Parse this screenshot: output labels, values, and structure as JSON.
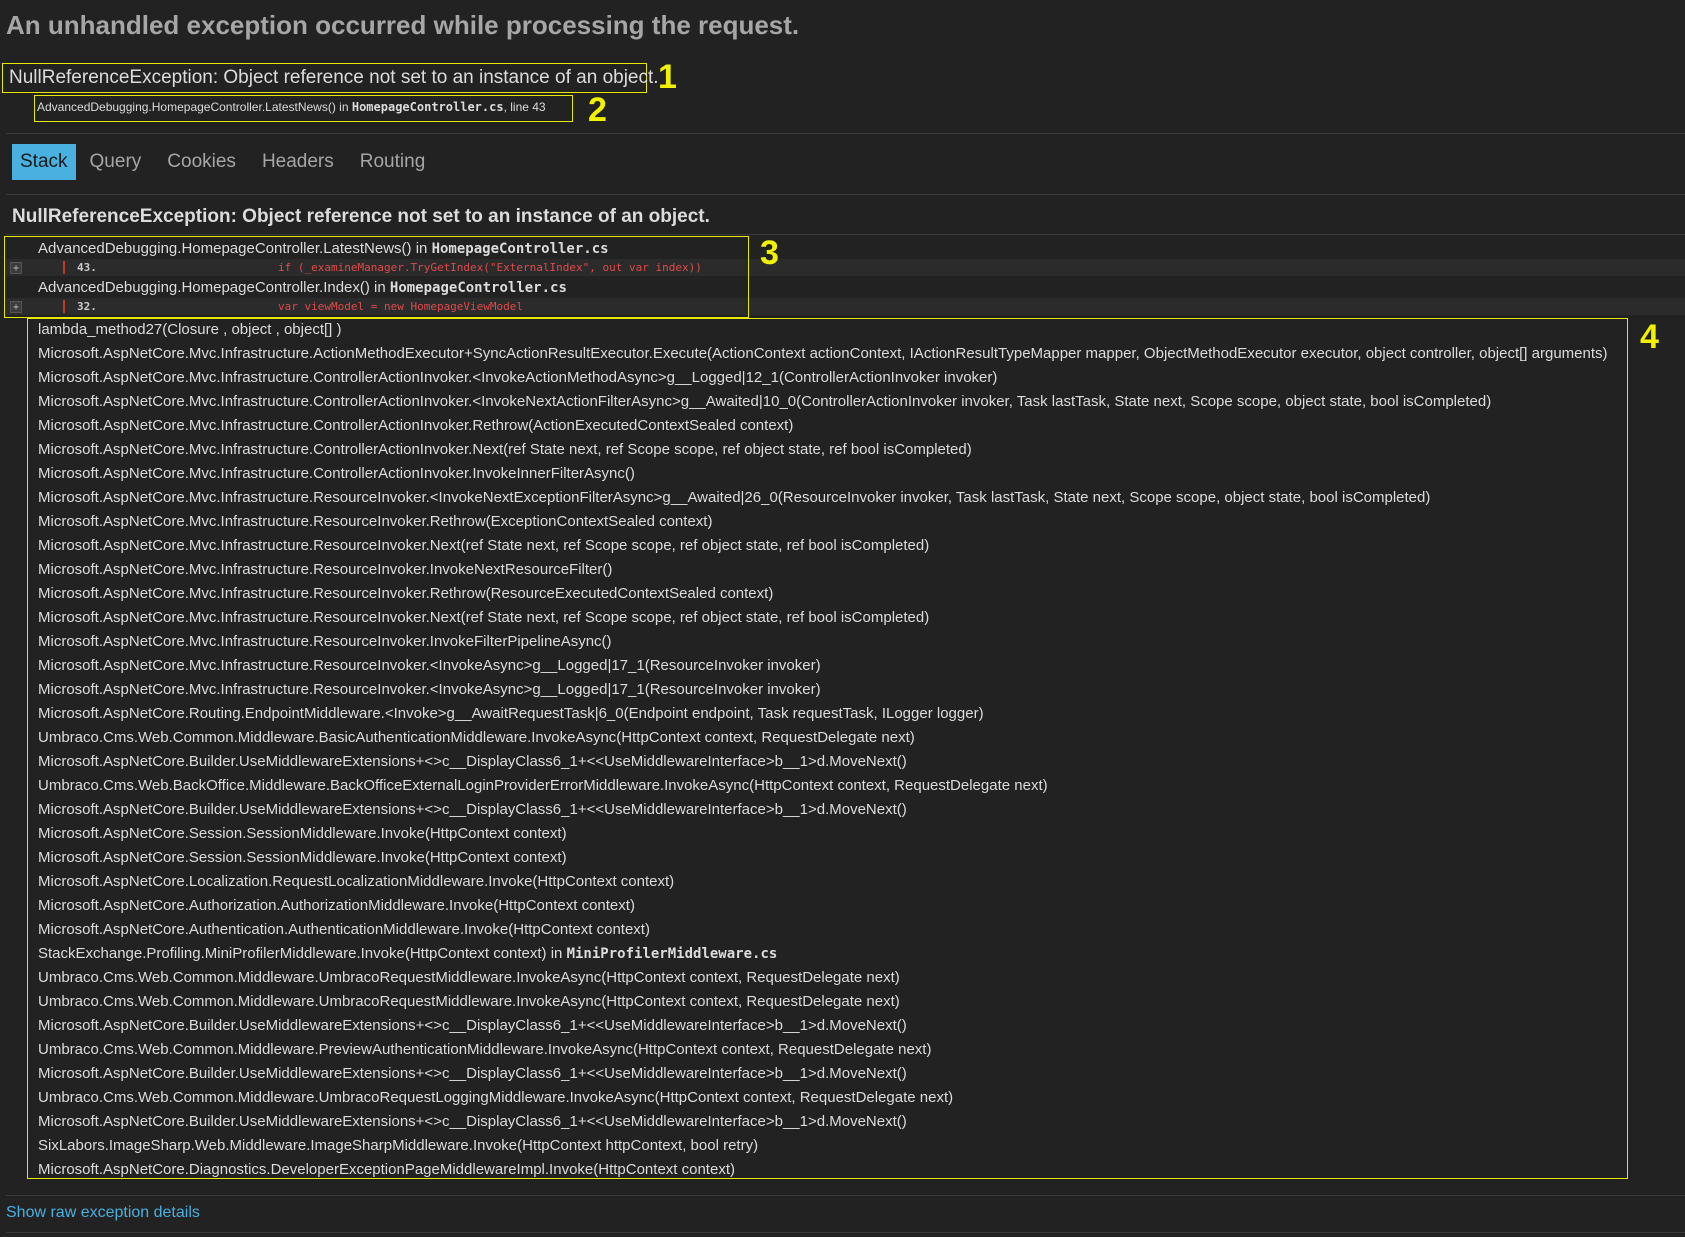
{
  "page": {
    "title": "An unhandled exception occurred while processing the request."
  },
  "exception": {
    "summary": "NullReferenceException: Object reference not set to an instance of an object.",
    "location_method": "AdvancedDebugging.HomepageController.LatestNews() in ",
    "location_file": "HomepageController.cs",
    "location_line": ", line 43"
  },
  "annotations": [
    "1",
    "2",
    "3",
    "4"
  ],
  "tabs": [
    {
      "label": "Stack",
      "active": true
    },
    {
      "label": "Query",
      "active": false
    },
    {
      "label": "Cookies",
      "active": false
    },
    {
      "label": "Headers",
      "active": false
    },
    {
      "label": "Routing",
      "active": false
    }
  ],
  "stack": {
    "heading": "NullReferenceException: Object reference not set to an instance of an object.",
    "expand_symbol": "+",
    "top_frames": [
      {
        "method": "AdvancedDebugging.HomepageController.LatestNews() in ",
        "file": "HomepageController.cs",
        "line_number": "43.",
        "code": "if (_examineManager.TryGetIndex(\"ExternalIndex\", out var index))"
      },
      {
        "method": "AdvancedDebugging.HomepageController.Index() in ",
        "file": "HomepageController.cs",
        "line_number": "32.",
        "code": "var viewModel = new HomepageViewModel"
      }
    ],
    "frames": [
      {
        "method": "lambda_method27(Closure , object , object[] )"
      },
      {
        "method": "Microsoft.AspNetCore.Mvc.Infrastructure.ActionMethodExecutor+SyncActionResultExecutor.Execute(ActionContext actionContext, IActionResultTypeMapper mapper, ObjectMethodExecutor executor, object controller, object[] arguments)"
      },
      {
        "method": "Microsoft.AspNetCore.Mvc.Infrastructure.ControllerActionInvoker.<InvokeActionMethodAsync>g__Logged|12_1(ControllerActionInvoker invoker)"
      },
      {
        "method": "Microsoft.AspNetCore.Mvc.Infrastructure.ControllerActionInvoker.<InvokeNextActionFilterAsync>g__Awaited|10_0(ControllerActionInvoker invoker, Task lastTask, State next, Scope scope, object state, bool isCompleted)"
      },
      {
        "method": "Microsoft.AspNetCore.Mvc.Infrastructure.ControllerActionInvoker.Rethrow(ActionExecutedContextSealed context)"
      },
      {
        "method": "Microsoft.AspNetCore.Mvc.Infrastructure.ControllerActionInvoker.Next(ref State next, ref Scope scope, ref object state, ref bool isCompleted)"
      },
      {
        "method": "Microsoft.AspNetCore.Mvc.Infrastructure.ControllerActionInvoker.InvokeInnerFilterAsync()"
      },
      {
        "method": "Microsoft.AspNetCore.Mvc.Infrastructure.ResourceInvoker.<InvokeNextExceptionFilterAsync>g__Awaited|26_0(ResourceInvoker invoker, Task lastTask, State next, Scope scope, object state, bool isCompleted)"
      },
      {
        "method": "Microsoft.AspNetCore.Mvc.Infrastructure.ResourceInvoker.Rethrow(ExceptionContextSealed context)"
      },
      {
        "method": "Microsoft.AspNetCore.Mvc.Infrastructure.ResourceInvoker.Next(ref State next, ref Scope scope, ref object state, ref bool isCompleted)"
      },
      {
        "method": "Microsoft.AspNetCore.Mvc.Infrastructure.ResourceInvoker.InvokeNextResourceFilter()"
      },
      {
        "method": "Microsoft.AspNetCore.Mvc.Infrastructure.ResourceInvoker.Rethrow(ResourceExecutedContextSealed context)"
      },
      {
        "method": "Microsoft.AspNetCore.Mvc.Infrastructure.ResourceInvoker.Next(ref State next, ref Scope scope, ref object state, ref bool isCompleted)"
      },
      {
        "method": "Microsoft.AspNetCore.Mvc.Infrastructure.ResourceInvoker.InvokeFilterPipelineAsync()"
      },
      {
        "method": "Microsoft.AspNetCore.Mvc.Infrastructure.ResourceInvoker.<InvokeAsync>g__Logged|17_1(ResourceInvoker invoker)"
      },
      {
        "method": "Microsoft.AspNetCore.Mvc.Infrastructure.ResourceInvoker.<InvokeAsync>g__Logged|17_1(ResourceInvoker invoker)"
      },
      {
        "method": "Microsoft.AspNetCore.Routing.EndpointMiddleware.<Invoke>g__AwaitRequestTask|6_0(Endpoint endpoint, Task requestTask, ILogger logger)"
      },
      {
        "method": "Umbraco.Cms.Web.Common.Middleware.BasicAuthenticationMiddleware.InvokeAsync(HttpContext context, RequestDelegate next)"
      },
      {
        "method": "Microsoft.AspNetCore.Builder.UseMiddlewareExtensions+<>c__DisplayClass6_1+<<UseMiddlewareInterface>b__1>d.MoveNext()"
      },
      {
        "method": "Umbraco.Cms.Web.BackOffice.Middleware.BackOfficeExternalLoginProviderErrorMiddleware.InvokeAsync(HttpContext context, RequestDelegate next)"
      },
      {
        "method": "Microsoft.AspNetCore.Builder.UseMiddlewareExtensions+<>c__DisplayClass6_1+<<UseMiddlewareInterface>b__1>d.MoveNext()"
      },
      {
        "method": "Microsoft.AspNetCore.Session.SessionMiddleware.Invoke(HttpContext context)"
      },
      {
        "method": "Microsoft.AspNetCore.Session.SessionMiddleware.Invoke(HttpContext context)"
      },
      {
        "method": "Microsoft.AspNetCore.Localization.RequestLocalizationMiddleware.Invoke(HttpContext context)"
      },
      {
        "method": "Microsoft.AspNetCore.Authorization.AuthorizationMiddleware.Invoke(HttpContext context)"
      },
      {
        "method": "Microsoft.AspNetCore.Authentication.AuthenticationMiddleware.Invoke(HttpContext context)"
      },
      {
        "method": "StackExchange.Profiling.MiniProfilerMiddleware.Invoke(HttpContext context) in ",
        "file": "MiniProfilerMiddleware.cs"
      },
      {
        "method": "Umbraco.Cms.Web.Common.Middleware.UmbracoRequestMiddleware.InvokeAsync(HttpContext context, RequestDelegate next)"
      },
      {
        "method": "Umbraco.Cms.Web.Common.Middleware.UmbracoRequestMiddleware.InvokeAsync(HttpContext context, RequestDelegate next)"
      },
      {
        "method": "Microsoft.AspNetCore.Builder.UseMiddlewareExtensions+<>c__DisplayClass6_1+<<UseMiddlewareInterface>b__1>d.MoveNext()"
      },
      {
        "method": "Umbraco.Cms.Web.Common.Middleware.PreviewAuthenticationMiddleware.InvokeAsync(HttpContext context, RequestDelegate next)"
      },
      {
        "method": "Microsoft.AspNetCore.Builder.UseMiddlewareExtensions+<>c__DisplayClass6_1+<<UseMiddlewareInterface>b__1>d.MoveNext()"
      },
      {
        "method": "Umbraco.Cms.Web.Common.Middleware.UmbracoRequestLoggingMiddleware.InvokeAsync(HttpContext context, RequestDelegate next)"
      },
      {
        "method": "Microsoft.AspNetCore.Builder.UseMiddlewareExtensions+<>c__DisplayClass6_1+<<UseMiddlewareInterface>b__1>d.MoveNext()"
      },
      {
        "method": "SixLabors.ImageSharp.Web.Middleware.ImageSharpMiddleware.Invoke(HttpContext httpContext, bool retry)"
      },
      {
        "method": "Microsoft.AspNetCore.Diagnostics.DeveloperExceptionPageMiddlewareImpl.Invoke(HttpContext context)"
      }
    ]
  },
  "footer": {
    "raw_link": "Show raw exception details"
  },
  "colors": {
    "background": "#222222",
    "accent": "#4ab0e0",
    "annotation": "#f2f200",
    "code_error": "#e04a4a"
  }
}
